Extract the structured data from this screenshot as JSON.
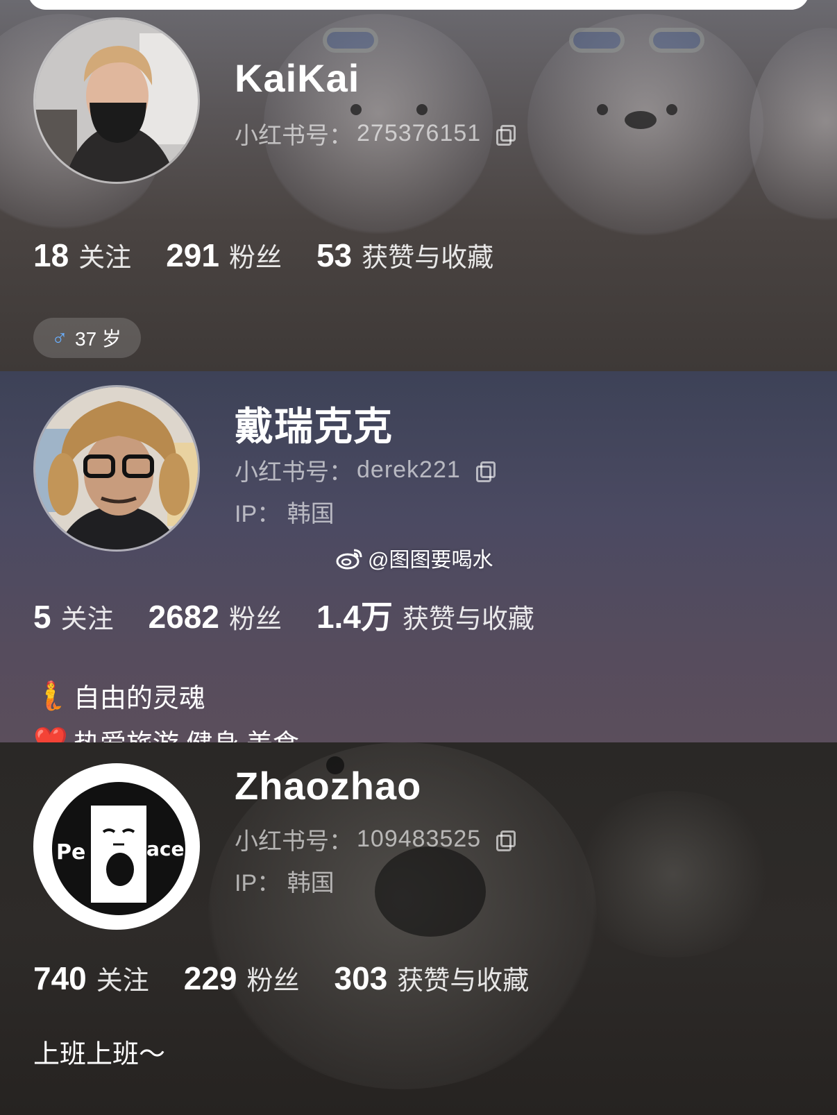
{
  "profiles": [
    {
      "name": "KaiKai",
      "id_label": "小红书号：",
      "id_value": "275376151",
      "stats": [
        {
          "num": "18",
          "label": "关注"
        },
        {
          "num": "291",
          "label": "粉丝"
        },
        {
          "num": "53",
          "label": "获赞与收藏"
        }
      ],
      "tag": {
        "icon": "male-icon",
        "text": "37 岁"
      }
    },
    {
      "name": "戴瑞克克",
      "id_label": "小红书号：",
      "id_value": "derek221",
      "ip": "IP：  韩国",
      "watermark": "@图图要喝水",
      "stats": [
        {
          "num": "5",
          "label": "关注"
        },
        {
          "num": "2682",
          "label": "粉丝"
        },
        {
          "num": "1.4万",
          "label": "获赞与收藏"
        }
      ],
      "bio_lines": [
        {
          "icon": "🧜",
          "text": "自由的灵魂"
        },
        {
          "icon": "❤️",
          "text": "热爱旅游   健身   美食"
        }
      ]
    },
    {
      "name": "Zhaozhao",
      "id_label": "小红书号：",
      "id_value": "109483525",
      "ip": "IP：  韩国",
      "avatar_text_left": "Pe",
      "avatar_text_right": "ace",
      "stats": [
        {
          "num": "740",
          "label": "关注"
        },
        {
          "num": "229",
          "label": "粉丝"
        },
        {
          "num": "303",
          "label": "获赞与收藏"
        }
      ],
      "bio": "上班上班～"
    }
  ],
  "colors": {
    "accent_male": "#6ab0ff"
  }
}
